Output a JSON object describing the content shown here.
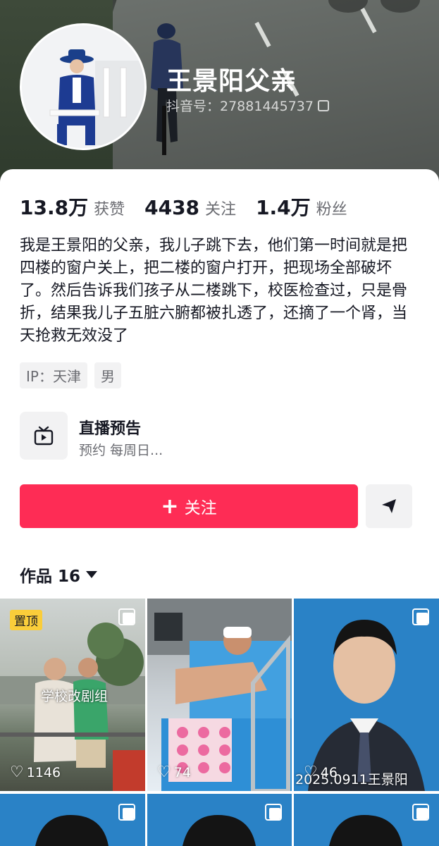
{
  "profile": {
    "name": "王景阳父亲",
    "douyin_id": "抖音号：27881445737"
  },
  "stats": [
    {
      "value": "13.8万",
      "label": "获赞"
    },
    {
      "value": "4438",
      "label": "关注"
    },
    {
      "value": "1.4万",
      "label": "粉丝"
    }
  ],
  "bio": "我是王景阳的父亲，我儿子跳下去，他们第一时间就是把四楼的窗户关上，把二楼的窗户打开，把现场全部破坏了。然后告诉我们孩子从二楼跳下，校医检查过，只是骨折，结果我儿子五脏六腑都被扎透了，还摘了一个肾，当天抢救无效没了",
  "tags": [
    "IP：天津",
    "男"
  ],
  "live": {
    "title": "直播预告",
    "subtitle": "预约 每周日..."
  },
  "actions": {
    "follow_label": "关注",
    "share_icon": "send-icon"
  },
  "works": {
    "label": "作品 16"
  },
  "videos": [
    {
      "pin": "置顶",
      "caption": "学校改剧组",
      "likes": "1146"
    },
    {
      "likes": "74"
    },
    {
      "likes": "46",
      "caption": "2025.0911王景阳"
    }
  ],
  "colors": {
    "accent": "#fe2c55",
    "pin_badge": "#facd3a"
  }
}
